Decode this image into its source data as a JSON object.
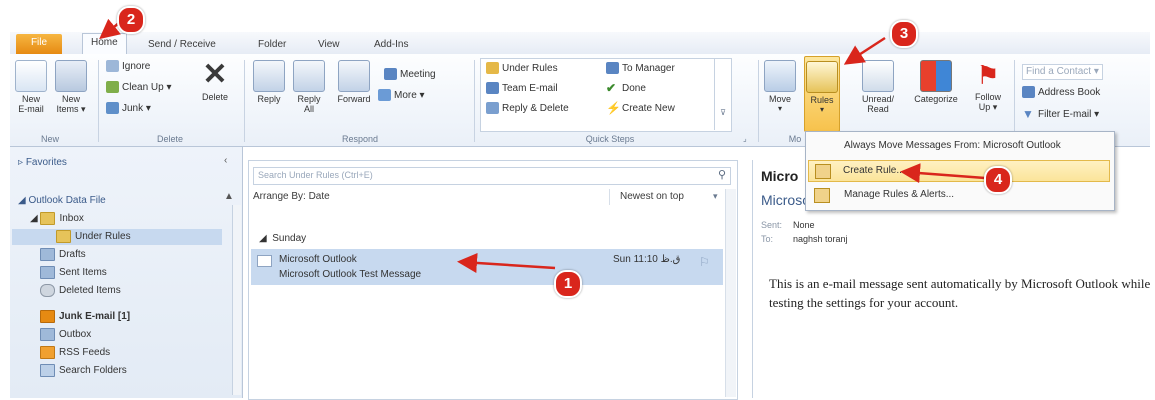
{
  "tabs": [
    "File",
    "Home",
    "Send / Receive",
    "Folder",
    "View",
    "Add-Ins"
  ],
  "ribbon": {
    "new": {
      "new_email": "New\nE-mail",
      "new_items": "New\nItems ▾",
      "label": "New"
    },
    "delete": {
      "ignore": "Ignore",
      "clean_up": "Clean Up ▾",
      "junk": "Junk ▾",
      "delete": "Delete",
      "label": "Delete"
    },
    "respond": {
      "reply": "Reply",
      "reply_all": "Reply\nAll",
      "forward": "Forward",
      "meeting": "Meeting",
      "more": "More ▾",
      "label": "Respond"
    },
    "quick_steps": {
      "under_rules": "Under Rules",
      "team_email": "Team E-mail",
      "reply_delete": "Reply & Delete",
      "to_manager": "To Manager",
      "done": "Done",
      "create_new": "Create New",
      "label": "Quick Steps"
    },
    "move": {
      "move": "Move",
      "rules": "Rules",
      "label": "Mo"
    },
    "tags": {
      "unread_read": "Unread/\nRead",
      "categorize": "Categorize",
      "follow_up": "Follow\nUp ▾"
    },
    "find": {
      "find_contact": "Find a Contact ▾",
      "address_book": "Address Book",
      "filter_email": "Filter E-mail ▾"
    }
  },
  "nav": {
    "favorites": "Favorites",
    "data_file": "Outlook Data File",
    "folders": [
      "Inbox",
      "Under Rules",
      "Drafts",
      "Sent Items",
      "Deleted Items",
      "Junk E-mail [1]",
      "Outbox",
      "RSS Feeds",
      "Search Folders"
    ]
  },
  "maillist": {
    "search_placeholder": "Search Under Rules (Ctrl+E)",
    "arrange_by": "Arrange By: Date",
    "sort": "Newest on top",
    "group": "Sunday",
    "message": {
      "sender": "Microsoft Outlook",
      "subject": "Microsoft Outlook Test Message",
      "time": "Sun 11:10 ق.ظ"
    }
  },
  "reading": {
    "title": "Micro",
    "from": "Microsoft Outlook",
    "sent_label": "Sent:",
    "sent_value": "None",
    "to_label": "To:",
    "to_value": "naghsh toranj",
    "body": "This is an e-mail message sent automatically by Microsoft Outlook while testing the settings for your account."
  },
  "rules_menu": {
    "always_move": "Always Move Messages From: Microsoft Outlook",
    "create_rule": "Create Rule...",
    "manage_rules": "Manage Rules & Alerts..."
  },
  "annotations": [
    "1",
    "2",
    "3",
    "4"
  ],
  "colors": {
    "accent": "#e68a12",
    "highlight": "#fbe49a",
    "annotation": "#d9261c",
    "selected": "#c7d9ef"
  }
}
